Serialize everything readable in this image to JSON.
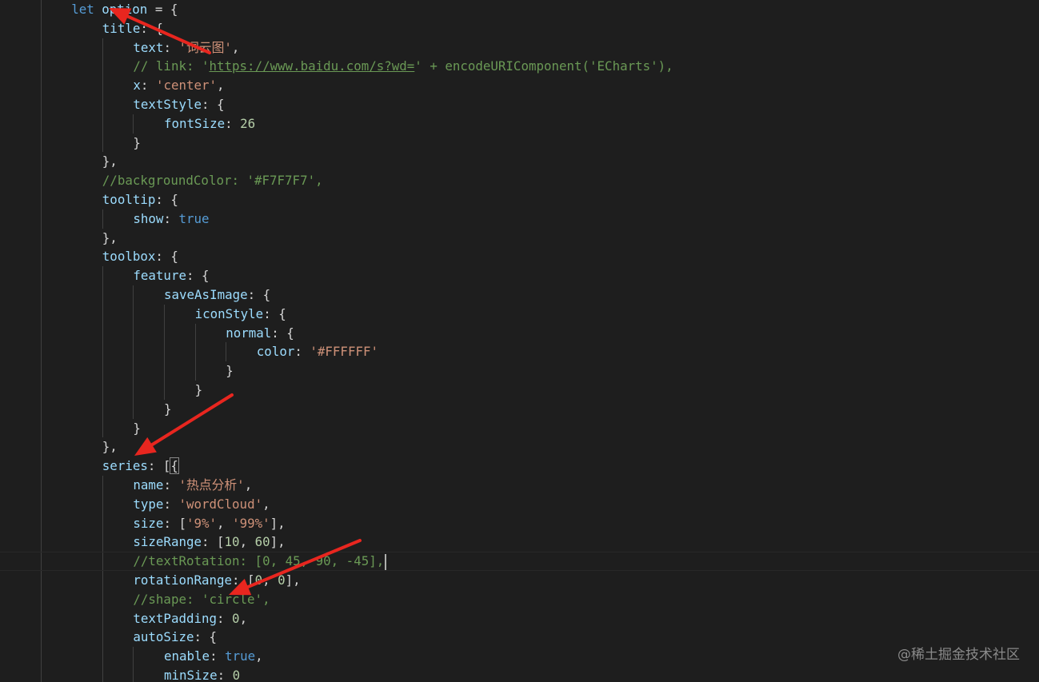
{
  "editor": {
    "colors": {
      "background": "#1e1e1e",
      "keyword": "#569cd6",
      "property": "#9cdcfe",
      "string": "#ce9178",
      "number": "#b5cea8",
      "comment": "#6a9955",
      "function": "#dcdcaa",
      "punctuation": "#d4d4d4",
      "annotation_arrow": "#e8261f"
    },
    "lines": [
      {
        "indent": 2,
        "tokens": [
          {
            "t": "let ",
            "c": "keyword"
          },
          {
            "t": "option",
            "c": "var"
          },
          {
            "t": " = {",
            "c": "punct"
          }
        ]
      },
      {
        "indent": 3,
        "tokens": [
          {
            "t": "title",
            "c": "prop"
          },
          {
            "t": ": {",
            "c": "punct"
          }
        ]
      },
      {
        "indent": 4,
        "tokens": [
          {
            "t": "text",
            "c": "prop"
          },
          {
            "t": ": ",
            "c": "punct"
          },
          {
            "t": "'词云图'",
            "c": "string"
          },
          {
            "t": ",",
            "c": "punct"
          }
        ]
      },
      {
        "indent": 4,
        "tokens": [
          {
            "t": "// link: '",
            "c": "comment"
          },
          {
            "t": "https://www.baidu.com/s?wd=",
            "c": "link"
          },
          {
            "t": "' + encodeURIComponent('ECharts'),",
            "c": "comment"
          }
        ]
      },
      {
        "indent": 4,
        "tokens": [
          {
            "t": "x",
            "c": "prop"
          },
          {
            "t": ": ",
            "c": "punct"
          },
          {
            "t": "'center'",
            "c": "string"
          },
          {
            "t": ",",
            "c": "punct"
          }
        ]
      },
      {
        "indent": 4,
        "tokens": [
          {
            "t": "textStyle",
            "c": "prop"
          },
          {
            "t": ": {",
            "c": "punct"
          }
        ]
      },
      {
        "indent": 5,
        "tokens": [
          {
            "t": "fontSize",
            "c": "prop"
          },
          {
            "t": ": ",
            "c": "punct"
          },
          {
            "t": "26",
            "c": "number"
          }
        ]
      },
      {
        "indent": 4,
        "tokens": [
          {
            "t": "}",
            "c": "punct"
          }
        ]
      },
      {
        "indent": 3,
        "tokens": [
          {
            "t": "},",
            "c": "punct"
          }
        ]
      },
      {
        "indent": 3,
        "tokens": [
          {
            "t": "//backgroundColor: '#F7F7F7',",
            "c": "comment"
          }
        ]
      },
      {
        "indent": 3,
        "tokens": [
          {
            "t": "tooltip",
            "c": "prop"
          },
          {
            "t": ": {",
            "c": "punct"
          }
        ]
      },
      {
        "indent": 4,
        "tokens": [
          {
            "t": "show",
            "c": "prop"
          },
          {
            "t": ": ",
            "c": "punct"
          },
          {
            "t": "true",
            "c": "keyword"
          }
        ]
      },
      {
        "indent": 3,
        "tokens": [
          {
            "t": "},",
            "c": "punct"
          }
        ]
      },
      {
        "indent": 3,
        "tokens": [
          {
            "t": "toolbox",
            "c": "prop"
          },
          {
            "t": ": {",
            "c": "punct"
          }
        ]
      },
      {
        "indent": 4,
        "tokens": [
          {
            "t": "feature",
            "c": "prop"
          },
          {
            "t": ": {",
            "c": "punct"
          }
        ]
      },
      {
        "indent": 5,
        "tokens": [
          {
            "t": "saveAsImage",
            "c": "prop"
          },
          {
            "t": ": {",
            "c": "punct"
          }
        ]
      },
      {
        "indent": 6,
        "tokens": [
          {
            "t": "iconStyle",
            "c": "prop"
          },
          {
            "t": ": {",
            "c": "punct"
          }
        ]
      },
      {
        "indent": 7,
        "tokens": [
          {
            "t": "normal",
            "c": "prop"
          },
          {
            "t": ": {",
            "c": "punct"
          }
        ]
      },
      {
        "indent": 8,
        "tokens": [
          {
            "t": "color",
            "c": "prop"
          },
          {
            "t": ": ",
            "c": "punct"
          },
          {
            "t": "'#FFFFFF'",
            "c": "string"
          }
        ]
      },
      {
        "indent": 7,
        "tokens": [
          {
            "t": "}",
            "c": "punct"
          }
        ]
      },
      {
        "indent": 6,
        "tokens": [
          {
            "t": "}",
            "c": "punct"
          }
        ]
      },
      {
        "indent": 5,
        "tokens": [
          {
            "t": "}",
            "c": "punct"
          }
        ]
      },
      {
        "indent": 4,
        "tokens": [
          {
            "t": "}",
            "c": "punct"
          }
        ]
      },
      {
        "indent": 3,
        "tokens": [
          {
            "t": "},",
            "c": "punct"
          }
        ]
      },
      {
        "indent": 3,
        "tokens": [
          {
            "t": "series",
            "c": "prop"
          },
          {
            "t": ": [",
            "c": "punct"
          },
          {
            "t": "{",
            "c": "punct",
            "match": true
          }
        ]
      },
      {
        "indent": 4,
        "tokens": [
          {
            "t": "name",
            "c": "prop"
          },
          {
            "t": ": ",
            "c": "punct"
          },
          {
            "t": "'热点分析'",
            "c": "string"
          },
          {
            "t": ",",
            "c": "punct"
          }
        ]
      },
      {
        "indent": 4,
        "tokens": [
          {
            "t": "type",
            "c": "prop"
          },
          {
            "t": ": ",
            "c": "punct"
          },
          {
            "t": "'wordCloud'",
            "c": "string"
          },
          {
            "t": ",",
            "c": "punct"
          }
        ]
      },
      {
        "indent": 4,
        "tokens": [
          {
            "t": "size",
            "c": "prop"
          },
          {
            "t": ": [",
            "c": "punct"
          },
          {
            "t": "'9%'",
            "c": "string"
          },
          {
            "t": ", ",
            "c": "punct"
          },
          {
            "t": "'99%'",
            "c": "string"
          },
          {
            "t": "],",
            "c": "punct"
          }
        ]
      },
      {
        "indent": 4,
        "tokens": [
          {
            "t": "sizeRange",
            "c": "prop"
          },
          {
            "t": ": [",
            "c": "punct"
          },
          {
            "t": "10",
            "c": "number"
          },
          {
            "t": ", ",
            "c": "punct"
          },
          {
            "t": "60",
            "c": "number"
          },
          {
            "t": "],",
            "c": "punct"
          }
        ]
      },
      {
        "indent": 4,
        "current": true,
        "cursor": true,
        "tokens": [
          {
            "t": "//textRotation: [0, 45, 90, -45],",
            "c": "comment"
          }
        ]
      },
      {
        "indent": 4,
        "tokens": [
          {
            "t": "rotationRange",
            "c": "prop"
          },
          {
            "t": ": [",
            "c": "punct"
          },
          {
            "t": "0",
            "c": "number"
          },
          {
            "t": ", ",
            "c": "punct"
          },
          {
            "t": "0",
            "c": "number"
          },
          {
            "t": "],",
            "c": "punct"
          }
        ]
      },
      {
        "indent": 4,
        "tokens": [
          {
            "t": "//shape: 'circle',",
            "c": "comment"
          }
        ]
      },
      {
        "indent": 4,
        "tokens": [
          {
            "t": "textPadding",
            "c": "prop"
          },
          {
            "t": ": ",
            "c": "punct"
          },
          {
            "t": "0",
            "c": "number"
          },
          {
            "t": ",",
            "c": "punct"
          }
        ]
      },
      {
        "indent": 4,
        "tokens": [
          {
            "t": "autoSize",
            "c": "prop"
          },
          {
            "t": ": {",
            "c": "punct"
          }
        ]
      },
      {
        "indent": 5,
        "tokens": [
          {
            "t": "enable",
            "c": "prop"
          },
          {
            "t": ": ",
            "c": "punct"
          },
          {
            "t": "true",
            "c": "keyword"
          },
          {
            "t": ",",
            "c": "punct"
          }
        ]
      },
      {
        "indent": 5,
        "tokens": [
          {
            "t": "minSize",
            "c": "prop"
          },
          {
            "t": ": ",
            "c": "punct"
          },
          {
            "t": "0",
            "c": "number"
          }
        ]
      }
    ]
  },
  "watermark": {
    "text": "@稀土掘金技术社区"
  }
}
